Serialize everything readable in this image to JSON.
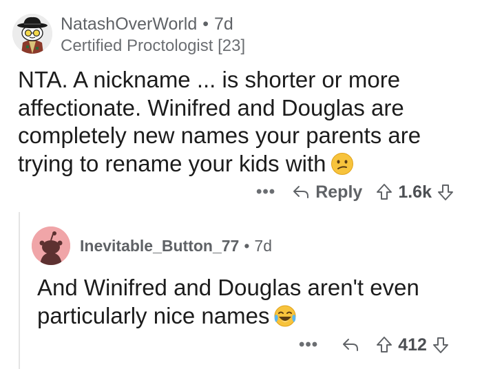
{
  "comment": {
    "author": "NatashOverWorld",
    "age": "7d",
    "flair": "Certified Proctologist [23]",
    "body": "NTA. A nickname ... is shorter or more affectionate. Winifred and Douglas are completely new names your parents are trying to rename your kids with",
    "emoji": "confused-face-emoji",
    "actions": {
      "more": "•••",
      "reply_label": "Reply",
      "score": "1.6k"
    }
  },
  "reply": {
    "author": "Inevitable_Button_77",
    "age": "7d",
    "body": "And Winifred and Douglas aren't even particularly nice names",
    "emoji": "tears-of-joy-emoji",
    "actions": {
      "more": "•••",
      "score": "412"
    }
  },
  "separator": "•",
  "colors": {
    "meta_text": "#5f6266",
    "body_text": "#1c1c1c",
    "reply_avatar_bg": "#f0a5a8",
    "thread_line": "#e4e4e4"
  }
}
